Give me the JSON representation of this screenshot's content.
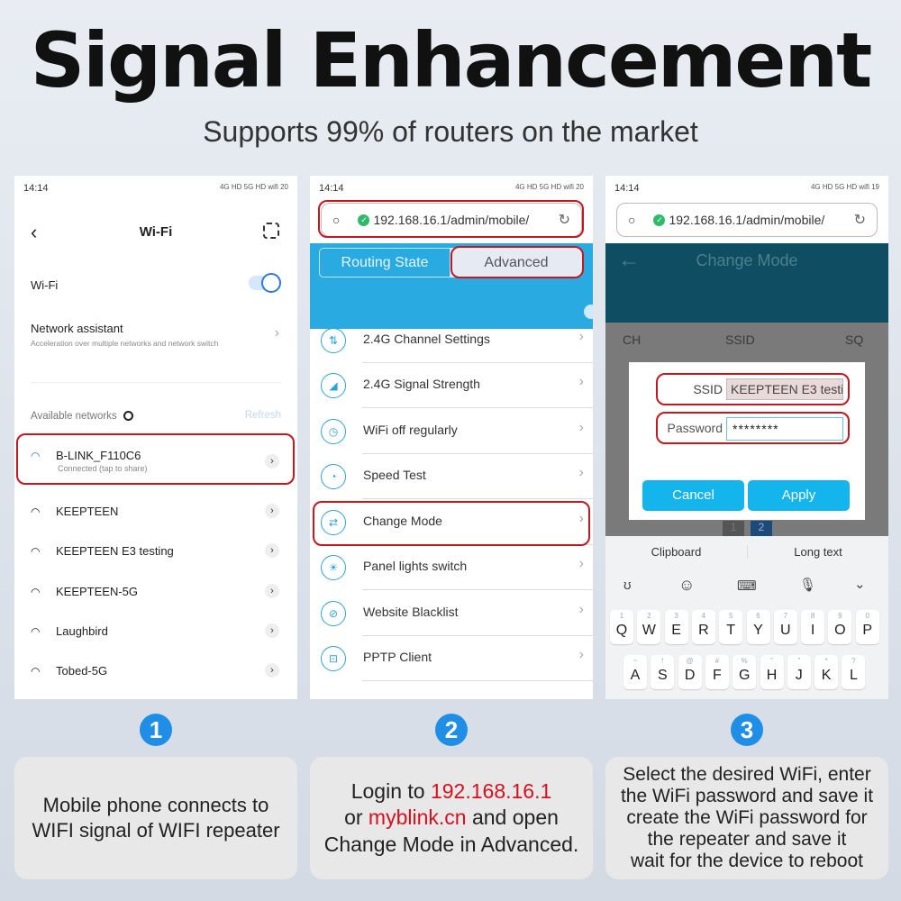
{
  "title": "Signal Enhancement",
  "subtitle": "Supports 99% of routers on the market",
  "colors": {
    "accent_blue": "#1f8ee6",
    "highlight_red": "#d8101e",
    "router_blue": "#29aae1",
    "dialog_button": "#14b4ec"
  },
  "panel1": {
    "time": "14:14",
    "status_icons": "4G HD  5G HD  wifi  20",
    "header": "Wi-Fi",
    "back_icon": "chevron-left-icon",
    "scan_icon": "scan-icon",
    "wifi_label": "Wi-Fi",
    "wifi_on": true,
    "assistant_title": "Network assistant",
    "assistant_desc": "Acceleration over multiple networks and network switch",
    "available_label": "Available networks",
    "refresh": "Refresh",
    "networks": [
      {
        "name": "B-LINK_F110C6",
        "status": "Connected (tap to share)"
      },
      {
        "name": "KEEPTEEN"
      },
      {
        "name": "KEEPTEEN E3 testing"
      },
      {
        "name": "KEEPTEEN-5G"
      },
      {
        "name": "Laughbird"
      },
      {
        "name": "Tobed-5G"
      }
    ]
  },
  "panel2": {
    "time": "14:14",
    "status_icons": "4G HD  5G HD  wifi  20",
    "url": "192.168.16.1/admin/mobile/",
    "tabs": [
      "Routing State",
      "Advanced"
    ],
    "menu": [
      "2.4G Channel Settings",
      "2.4G Signal Strength",
      "WiFi off regularly",
      "Speed Test",
      "Change Mode",
      "Panel lights switch",
      "Website Blacklist",
      "PPTP Client"
    ]
  },
  "panel3": {
    "time": "14:14",
    "status_icons": "4G HD  5G HD  wifi  19",
    "url": "192.168.16.1/admin/mobile/",
    "header": "Change Mode",
    "columns": [
      "CH",
      "SSID",
      "SQ"
    ],
    "ssid_label": "SSID",
    "ssid_value": "KEEPTEEN E3 testi",
    "password_label": "Password",
    "password_value": "********",
    "cancel": "Cancel",
    "apply": "Apply",
    "pages": [
      "1",
      "2"
    ],
    "keyboard": {
      "clipboard": "Clipboard",
      "long_text": "Long text",
      "row1": [
        [
          "1",
          "Q"
        ],
        [
          "2",
          "W"
        ],
        [
          "3",
          "E"
        ],
        [
          "4",
          "R"
        ],
        [
          "5",
          "T"
        ],
        [
          "6",
          "Y"
        ],
        [
          "7",
          "U"
        ],
        [
          "8",
          "I"
        ],
        [
          "9",
          "O"
        ],
        [
          "0",
          "P"
        ]
      ],
      "row2": [
        [
          "~",
          "A"
        ],
        [
          "!",
          "S"
        ],
        [
          "@",
          "D"
        ],
        [
          "#",
          "F"
        ],
        [
          "%",
          "G"
        ],
        [
          "\"",
          "H"
        ],
        [
          "\"",
          "J"
        ],
        [
          "*",
          "K"
        ],
        [
          "?",
          "L"
        ]
      ]
    }
  },
  "steps": [
    {
      "n": "1",
      "lines": [
        "Mobile phone connects to",
        "WIFI signal of WIFI repeater"
      ]
    },
    {
      "n": "2",
      "login": "Login to ",
      "ip": "192.168.16.1",
      "or": "or ",
      "domain": "myblink.cn",
      "and_open": " and open",
      "last": "Change Mode in Advanced."
    },
    {
      "n": "3",
      "lines": [
        "Select the desired WiFi, enter",
        "the WiFi password and save it",
        "create the WiFi password for",
        "the repeater and save it",
        "wait for the device to reboot"
      ]
    }
  ]
}
